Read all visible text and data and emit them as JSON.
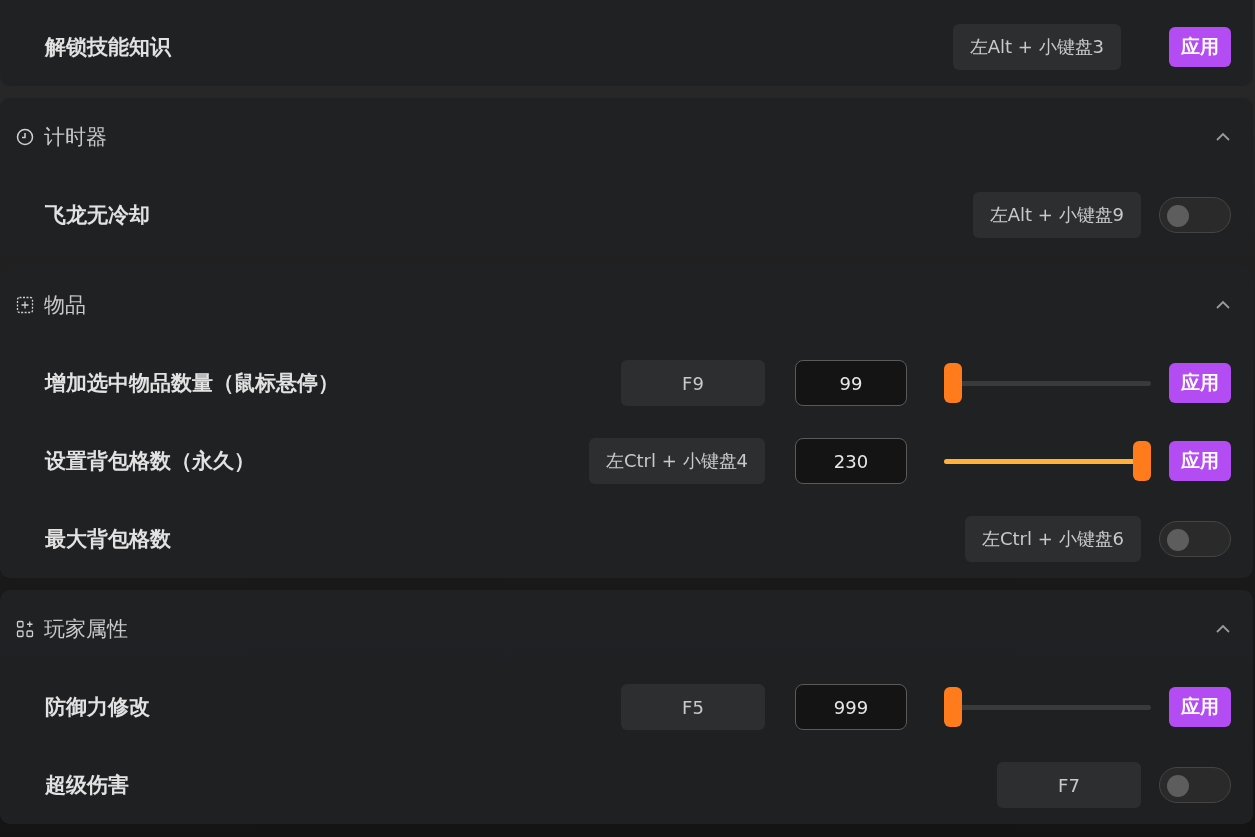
{
  "sections": [
    {
      "rows": [
        {
          "kind": "apply",
          "label": "解锁技能知识",
          "hotkey": "左Alt + 小键盘3",
          "button": "应用"
        }
      ]
    },
    {
      "title": "计时器",
      "expanded": true,
      "rows": [
        {
          "kind": "toggle",
          "label": "飞龙无冷却",
          "hotkey": "左Alt + 小键盘9",
          "on": false
        }
      ]
    },
    {
      "title": "物品",
      "expanded": true,
      "rows": [
        {
          "kind": "slider",
          "label": "增加选中物品数量（鼠标悬停）",
          "hotkey": "F9",
          "value": "99",
          "level": 0,
          "button": "应用"
        },
        {
          "kind": "slider",
          "label": "设置背包格数（永久）",
          "hotkey": "左Ctrl + 小键盘4",
          "value": "230",
          "level": 1,
          "button": "应用"
        },
        {
          "kind": "toggle",
          "label": "最大背包格数",
          "hotkey": "左Ctrl + 小键盘6",
          "on": false
        }
      ]
    },
    {
      "title": "玩家属性",
      "expanded": true,
      "rows": [
        {
          "kind": "slider",
          "label": "防御力修改",
          "hotkey": "F5",
          "value": "999",
          "level": 0,
          "button": "应用"
        },
        {
          "kind": "toggle",
          "label": "超级伤害",
          "hotkey": "F7",
          "on": false
        }
      ]
    }
  ]
}
